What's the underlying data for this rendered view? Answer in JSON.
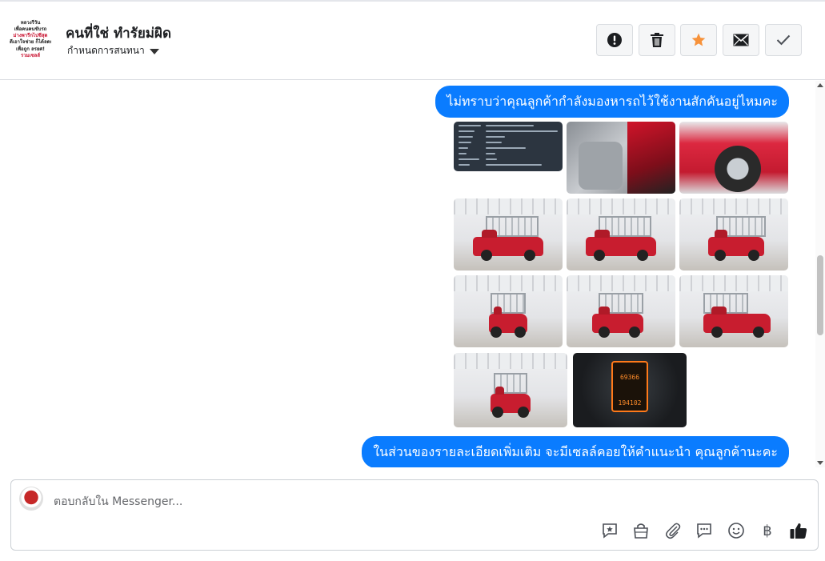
{
  "header": {
    "page_name": "คนที่ใช่ ทำรัยม่ผิด",
    "conversation_setting": "กำหนดการสนทนา",
    "avatar_lines": [
      "หลวงรีวัน",
      "เพื่อคนคนขับรถ",
      "ม่างพารีกไปชีสุด",
      "ดีเอาใจช่วย ก็ได้ลดต",
      "เพื่อถูก ลรยศ!",
      "รวมเซลส์"
    ],
    "actions": [
      {
        "name": "report",
        "icon": "exclamation-circle-icon"
      },
      {
        "name": "delete",
        "icon": "trash-icon"
      },
      {
        "name": "star",
        "icon": "star-icon",
        "color": "#f7923a"
      },
      {
        "name": "mark-unread",
        "icon": "envelope-icon"
      },
      {
        "name": "done",
        "icon": "check-icon"
      }
    ]
  },
  "conversation": {
    "bubble_color": "#0a7cff",
    "messages": [
      {
        "text": "ไม่ทราบว่าคุณลูกค้ากำลังมองหารถไว้ใช้งานสักคันอยู่ไหมคะ"
      },
      {
        "text": "ในส่วนของรายละเอียดเพิ่มเติม จะมีเซลล์คอยให้คำแนะนำ คุณลูกค้านะคะ"
      }
    ],
    "photos": [
      {
        "name": "spec-sheet"
      },
      {
        "name": "interior"
      },
      {
        "name": "wheel-closeup"
      },
      {
        "name": "truck-side-left"
      },
      {
        "name": "truck-side"
      },
      {
        "name": "truck-rear-angle"
      },
      {
        "name": "truck-rear"
      },
      {
        "name": "truck-rear-side"
      },
      {
        "name": "truck-front-angle"
      },
      {
        "name": "truck-front"
      },
      {
        "name": "odometer",
        "readout_top": "69366",
        "readout_bottom": "194102"
      }
    ]
  },
  "composer": {
    "placeholder": "ตอบกลับใน Messenger...",
    "tools": [
      "saved-reply-icon",
      "shop-bag-icon",
      "attachment-icon",
      "chat-bubble-icon",
      "emoji-icon",
      "baht-icon",
      "like-icon"
    ],
    "baht_symbol": "฿"
  }
}
